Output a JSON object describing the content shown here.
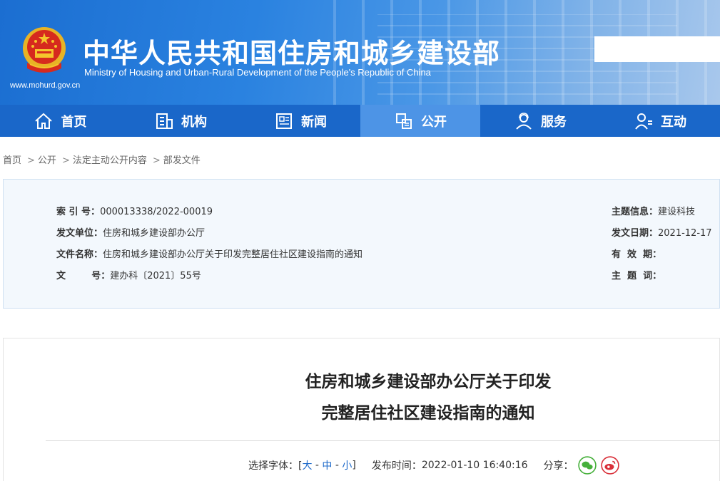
{
  "header": {
    "title": "中华人民共和国住房和城乡建设部",
    "subtitle": "Ministry of Housing and Urban-Rural Development of the People's Republic of China",
    "url": "www.mohurd.gov.cn",
    "emblem_icon": "national-emblem-icon"
  },
  "nav": {
    "items": [
      {
        "label": "首页",
        "icon": "home-icon"
      },
      {
        "label": "机构",
        "icon": "building-icon"
      },
      {
        "label": "新闻",
        "icon": "news-icon"
      },
      {
        "label": "公开",
        "icon": "document-icon",
        "active": true
      },
      {
        "label": "服务",
        "icon": "service-person-icon"
      },
      {
        "label": "互动",
        "icon": "interaction-person-icon"
      }
    ]
  },
  "breadcrumb": {
    "items": [
      "首页",
      "公开",
      "法定主动公开内容",
      "部发文件"
    ],
    "separator": ">"
  },
  "meta": {
    "index_label": "索  引  号：",
    "index_value": "000013338/2022-00019",
    "issuer_label": "发文单位：",
    "issuer_value": "住房和城乡建设部办公厅",
    "filename_label": "文件名称：",
    "filename_value": "住房和城乡建设部办公厅关于印发完整居住社区建设指南的通知",
    "docno_label": "文        号：",
    "docno_value": "建办科〔2021〕55号",
    "topic_label": "主题信息：",
    "topic_value": "建设科技",
    "date_label": "发文日期：",
    "date_value": "2021-12-17",
    "valid_label": "有  效  期：",
    "valid_value": "",
    "keywords_label": "主  题  词：",
    "keywords_value": ""
  },
  "article": {
    "title_line1": "住房和城乡建设部办公厅关于印发",
    "title_line2": "完整居住社区建设指南的通知",
    "font_label": "选择字体：[",
    "font_large": "大",
    "font_medium": "中",
    "font_small": "小",
    "font_close": "]",
    "dash": " - ",
    "publish_label": "发布时间：",
    "publish_time": "2022-01-10 16:40:16",
    "share_label": "分享：",
    "share_icons": [
      "wechat-icon",
      "weibo-icon"
    ]
  },
  "colors": {
    "nav_bg": "#1a67c9",
    "nav_active": "#4d94e6",
    "meta_bg": "#f3f8fd",
    "wechat": "#46b03b",
    "weibo": "#d9303a"
  }
}
